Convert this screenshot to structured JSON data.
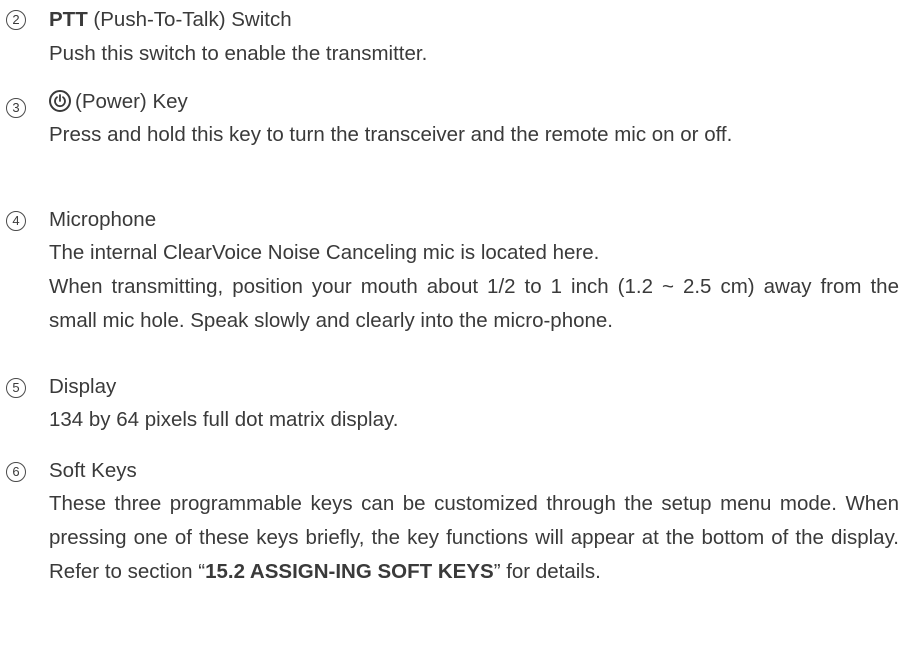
{
  "items": [
    {
      "number": "2",
      "title_bold": "PTT",
      "title_rest": " (Push-To-Talk) Switch",
      "body": "Push this switch to enable the transmitter."
    },
    {
      "number": "3",
      "icon": "power-icon",
      "title_rest": "(Power) Key",
      "body": "Press and hold this key to turn the transceiver and the remote mic on or off."
    },
    {
      "number": "4",
      "title_rest": "Microphone",
      "body_line1": "The internal ClearVoice Noise Canceling mic is located here.",
      "body_line2": "When transmitting, position your mouth about 1/2 to 1 inch (1.2 ~ 2.5 cm) away from the small mic hole. Speak slowly and clearly into the micro-phone."
    },
    {
      "number": "5",
      "title_rest": "Display",
      "body": "134 by 64 pixels full dot matrix display."
    },
    {
      "number": "6",
      "title_rest": "Soft Keys",
      "body_pre": "These three programmable keys can be customized through the setup menu mode. When pressing one of these keys briefly, the key functions will appear at the bottom of the display. Refer to section “",
      "body_bold": "15.2 ASSIGN-ING SOFT KEYS",
      "body_post": "” for details."
    }
  ]
}
